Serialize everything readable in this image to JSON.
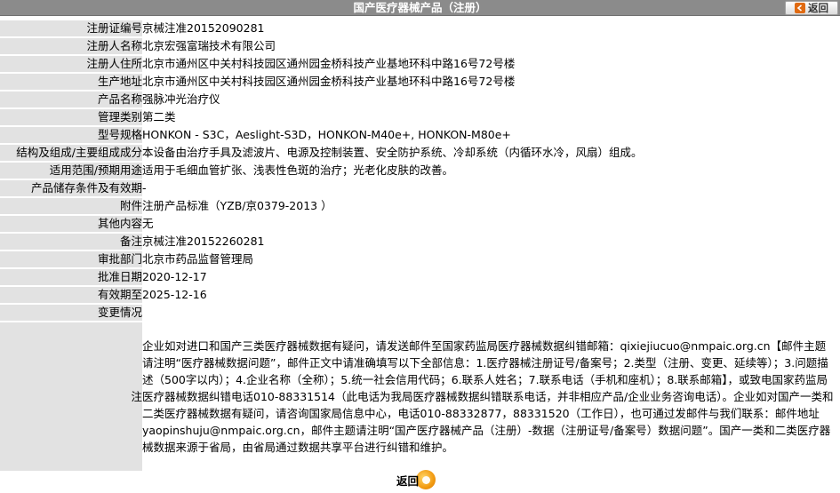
{
  "header": {
    "title": "国产医疗器械产品（注册）",
    "back_label": "返回"
  },
  "rows": [
    {
      "label": "注册证编号",
      "value": "京械注准20152090281"
    },
    {
      "label": "注册人名称",
      "value": "北京宏强富瑞技术有限公司"
    },
    {
      "label": "注册人住所",
      "value": "北京市通州区中关村科技园区通州园金桥科技产业基地环科中路16号72号楼"
    },
    {
      "label": "生产地址",
      "value": "北京市通州区中关村科技园区通州园金桥科技产业基地环科中路16号72号楼"
    },
    {
      "label": "产品名称",
      "value": "强脉冲光治疗仪"
    },
    {
      "label": "管理类别",
      "value": "第二类"
    },
    {
      "label": "型号规格",
      "value": "HONKON - S3C，Aeslight-S3D，HONKON-M40e+, HONKON-M80e+"
    },
    {
      "label": "结构及组成/主要组成成分",
      "value": "本设备由治疗手具及滤波片、电源及控制装置、安全防护系统、冷却系统（内循环水冷，风扇）组成。"
    },
    {
      "label": "适用范围/预期用途",
      "value": "适用于毛细血管扩张、浅表性色斑的治疗；光老化皮肤的改善。"
    },
    {
      "label": "产品储存条件及有效期",
      "value": "-"
    },
    {
      "label": "附件",
      "value": "注册产品标准（YZB/京0379-2013 ）"
    },
    {
      "label": "其他内容",
      "value": "无"
    },
    {
      "label": "备注",
      "value": "京械注准20152260281"
    },
    {
      "label": "审批部门",
      "value": "北京市药品监督管理局"
    },
    {
      "label": "批准日期",
      "value": "2020-12-17"
    },
    {
      "label": "有效期至",
      "value": "2025-12-16"
    },
    {
      "label": "变更情况",
      "value": ""
    }
  ],
  "note": {
    "label": "注",
    "text": "企业如对进口和国产三类医疗器械数据有疑问，请发送邮件至国家药监局医疗器械数据纠错邮箱：qixiejiucuo@nmpaic.org.cn【邮件主题请注明“医疗器械数据问题”，邮件正文中请准确填写以下全部信息：1.医疗器械注册证号/备案号；2.类型（注册、变更、延续等）；3.问题描述（500字以内）；4.企业名称（全称）；5.统一社会信用代码；6.联系人姓名；7.联系电话（手机和座机）；8.联系邮箱】，或致电国家药监局医疗器械数据纠错电话010-88331514（此电话为我局医疗器械数据纠错联系电话，并非相应产品/企业业务咨询电话）。企业如对国产一类和二类医疗器械数据有疑问，请咨询国家局信息中心，电话010-88332877，88331520（工作日），也可通过发邮件与我们联系：邮件地址yaopinshuju@nmpaic.org.cn，邮件主题请注明“国产医疗器械产品（注册）-数据（注册证号/备案号）数据问题”。国产一类和二类医疗器械数据来源于省局，由省局通过数据共享平台进行纠错和维护。"
  },
  "footer": {
    "back_label": "返回"
  },
  "colors": {
    "header_bg": "#8b8b8b",
    "label_bg": "#e2e2e2",
    "accent_orange": "#f29a10"
  }
}
